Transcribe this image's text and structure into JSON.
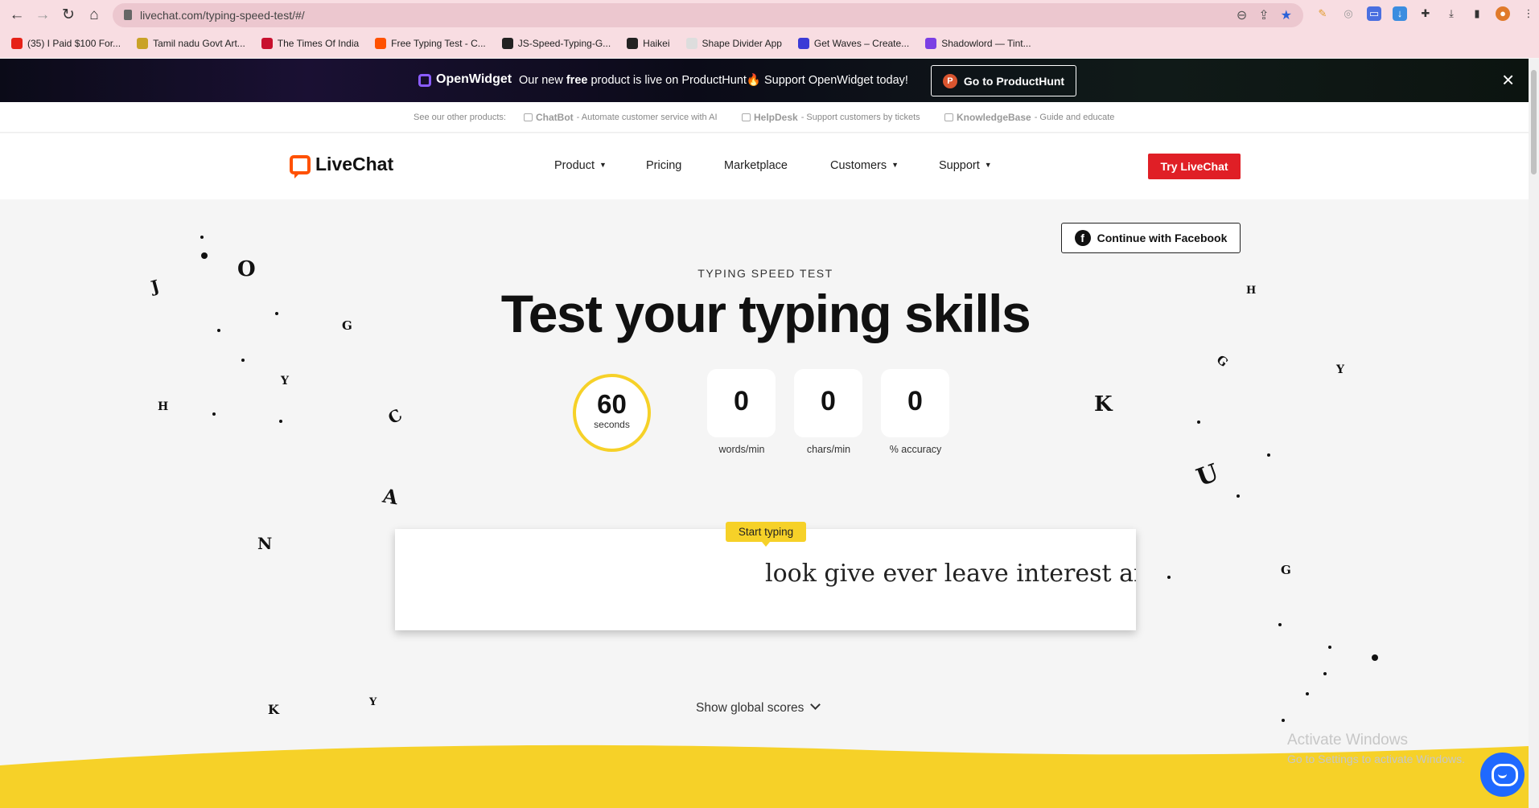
{
  "browser": {
    "url": "livechat.com/typing-speed-test/#/",
    "bookmarks": [
      {
        "label": "(35) I Paid $100 For...",
        "color": "#e62117"
      },
      {
        "label": "Tamil nadu Govt Art...",
        "color": "#c9a227"
      },
      {
        "label": "The Times Of India",
        "color": "#c8102e"
      },
      {
        "label": "Free Typing Test - C...",
        "color": "#ff5100"
      },
      {
        "label": "JS-Speed-Typing-G...",
        "color": "#222222"
      },
      {
        "label": "Haikei",
        "color": "#222222"
      },
      {
        "label": "Shape Divider App",
        "color": "#dddddd"
      },
      {
        "label": "Get Waves – Create...",
        "color": "#3b3bd6"
      },
      {
        "label": "Shadowlord — Tint...",
        "color": "#7b3fe4"
      }
    ]
  },
  "promo": {
    "brand": "OpenWidget",
    "msg_pre": "Our new ",
    "msg_bold": "free",
    "msg_post": " product is live on ProductHunt🔥 Support OpenWidget today!",
    "button": "Go to ProductHunt",
    "button_icon": "P"
  },
  "products": {
    "lead": "See our other products:",
    "items": [
      {
        "name": "ChatBot",
        "desc": "- Automate customer service with AI"
      },
      {
        "name": "HelpDesk",
        "desc": "- Support customers by tickets"
      },
      {
        "name": "KnowledgeBase",
        "desc": "- Guide and educate"
      }
    ]
  },
  "header": {
    "logo": "LiveChat",
    "nav": [
      {
        "label": "Product",
        "caret": "▼"
      },
      {
        "label": "Pricing",
        "caret": ""
      },
      {
        "label": "Marketplace",
        "caret": ""
      },
      {
        "label": "Customers",
        "caret": "▼"
      },
      {
        "label": "Support",
        "caret": "▼"
      }
    ],
    "cta": "Try LiveChat"
  },
  "main": {
    "facebook_button": "Continue with Facebook",
    "facebook_icon": "f",
    "eyebrow": "TYPING SPEED TEST",
    "title": "Test your typing skills",
    "timer": {
      "value": "60",
      "unit": "seconds"
    },
    "stats": [
      {
        "value": "0",
        "label": "words/min"
      },
      {
        "value": "0",
        "label": "chars/min"
      },
      {
        "value": "0",
        "label": "% accuracy"
      }
    ],
    "tooltip": "Start typing",
    "words": "look give ever leave interest any ",
    "global_scores": "Show global scores"
  },
  "watermark": {
    "line1": "Activate Windows",
    "line2": "Go to Settings to activate Windows."
  },
  "colors": {
    "accent": "#e01f26",
    "brand": "#ff5100",
    "yellow": "#f6d128",
    "chat": "#1f69ff"
  },
  "decor_letters": [
    "J",
    "O",
    "G",
    "H",
    "C",
    "A",
    "N",
    "K",
    "H",
    "K",
    "G",
    "U",
    "G",
    "Y",
    "Y",
    "Y"
  ]
}
